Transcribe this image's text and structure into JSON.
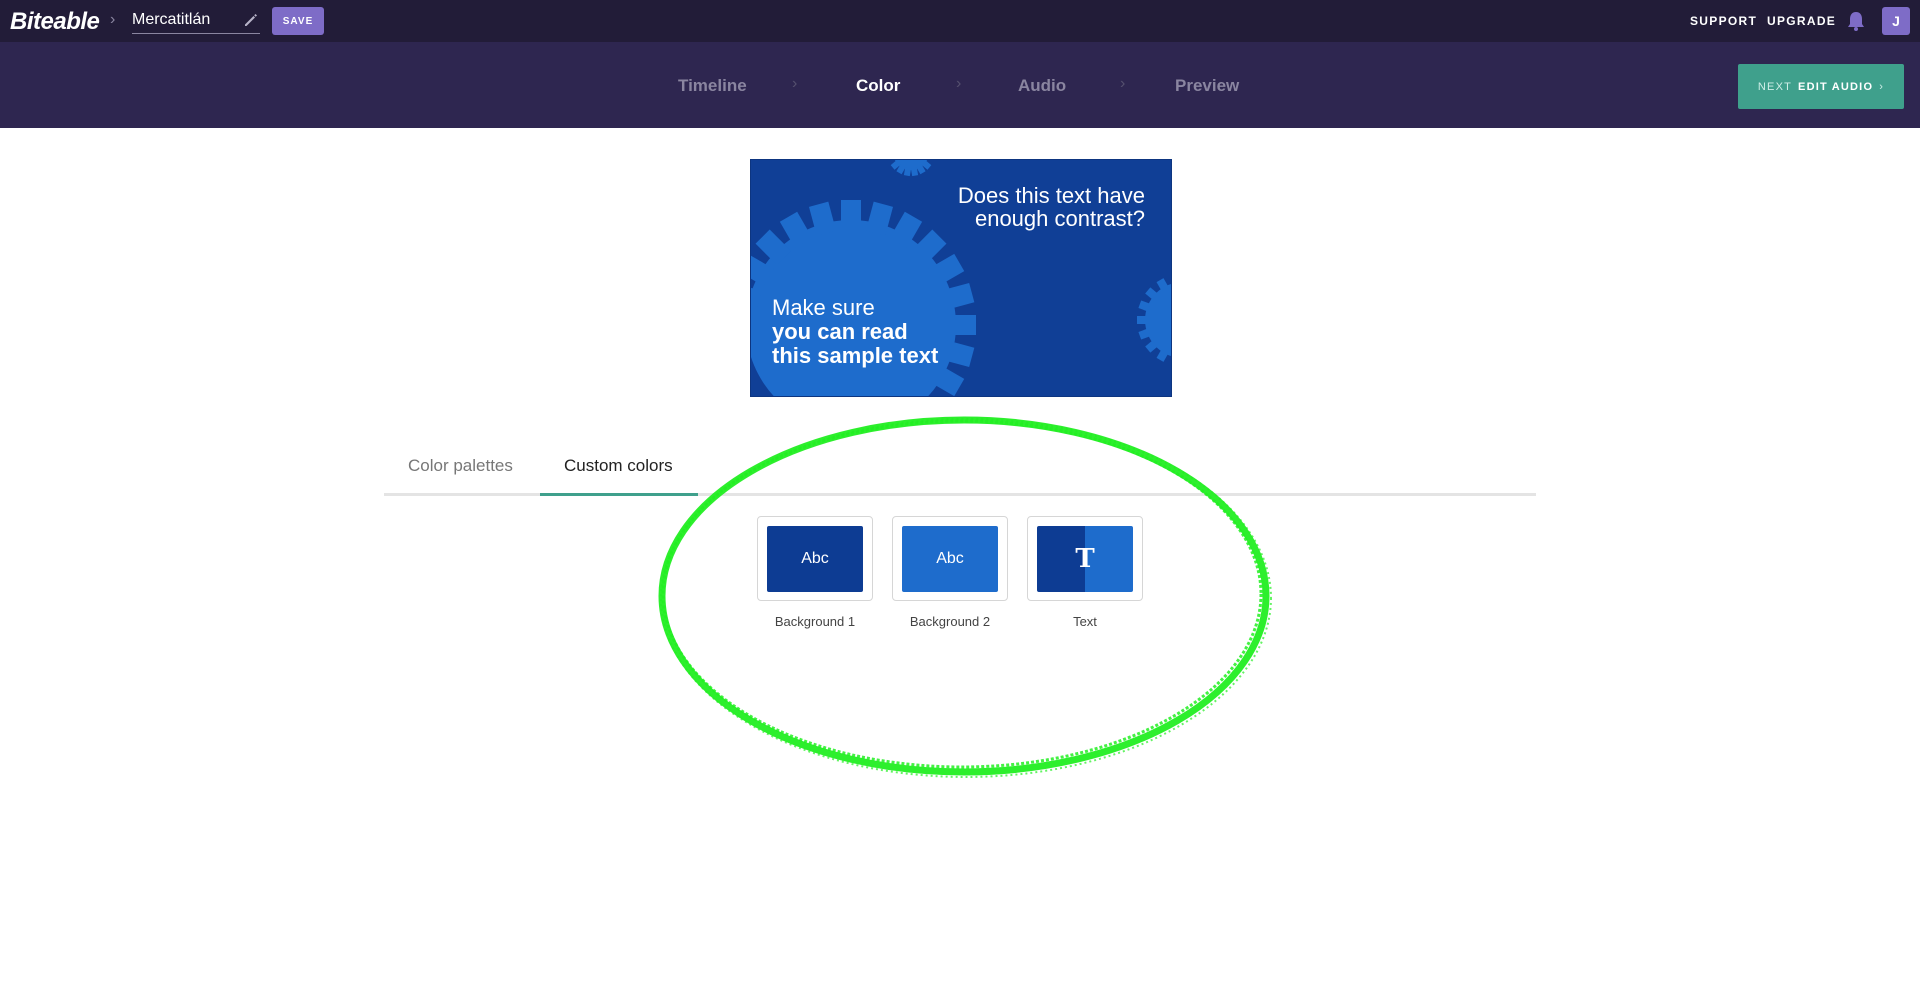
{
  "app": {
    "logo": "Biteable",
    "project_name": "Mercatitlán",
    "save_label": "SAVE",
    "support_label": "SUPPORT",
    "upgrade_label": "UPGRADE",
    "avatar_initial": "J"
  },
  "steps": {
    "items": [
      {
        "label": "Timeline",
        "active": false
      },
      {
        "label": "Color",
        "active": true
      },
      {
        "label": "Audio",
        "active": false
      },
      {
        "label": "Preview",
        "active": false
      }
    ],
    "next_prefix": "NEXT",
    "next_label": "EDIT AUDIO",
    "next_chevron": "›"
  },
  "preview": {
    "question_line1": "Does this text have",
    "question_line2": "enough contrast?",
    "main_line1": "Make sure",
    "main_line2": "you can read",
    "main_line3": "this sample text"
  },
  "tabs": {
    "palettes": "Color palettes",
    "custom": "Custom colors",
    "active": "custom"
  },
  "swatches": [
    {
      "label": "Background 1",
      "sample": "Abc",
      "color": "#0d3c93"
    },
    {
      "label": "Background 2",
      "sample": "Abc",
      "color": "#1e6ccc"
    },
    {
      "label": "Text",
      "sample": "T",
      "color_left": "#0d3c93",
      "color_right": "#1e6ccc"
    }
  ],
  "colors": {
    "topbar": "#221c38",
    "stepbar": "#2e2650",
    "accent_purple": "#7e6cc7",
    "accent_teal": "#3fa08c",
    "annotation_green": "#22ee22"
  }
}
